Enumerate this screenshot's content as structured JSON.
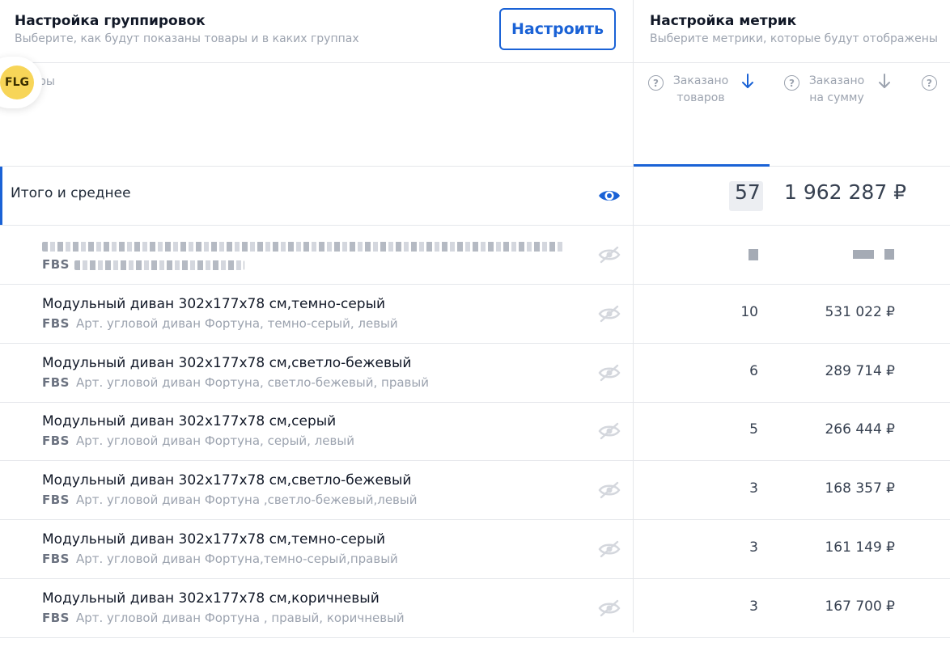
{
  "grouping": {
    "title": "Настройка группировок",
    "subtitle": "Выберите, как будут показаны товары и в каких группах",
    "button_label": "Настроить"
  },
  "metrics_settings": {
    "title": "Настройка метрик",
    "subtitle": "Выберите метрики, которые будут отображены"
  },
  "avatar": {
    "initials": "FLG",
    "color": "#f7d558"
  },
  "table": {
    "first_column_label_fragment": "ры",
    "metric_columns": [
      {
        "label_line1": "Заказано",
        "label_line2": "товаров",
        "sort": "desc-active",
        "icon": "arrow-down-icon"
      },
      {
        "label_line1": "Заказано",
        "label_line2": "на сумму",
        "sort": "desc",
        "icon": "arrow-down-icon"
      }
    ],
    "total": {
      "label": "Итого и среднее",
      "ordered_count": "57",
      "ordered_sum": "1 962 287 ₽"
    },
    "rows": [
      {
        "title": "Модульный диван 302х177х78 см,темно-серый",
        "fbs": "FBS",
        "article": "Арт. угловой диван Фортуна, темно-серый, левый",
        "count": "10",
        "sum": "531 022 ₽"
      },
      {
        "title": "Модульный диван 302х177х78 см,светло-бежевый",
        "fbs": "FBS",
        "article": "Арт. угловой диван Фортуна, светло-бежевый, правый",
        "count": "6",
        "sum": "289 714 ₽"
      },
      {
        "title": "Модульный диван 302х177х78 см,серый",
        "fbs": "FBS",
        "article": "Арт. угловой диван Фортуна, серый, левый",
        "count": "5",
        "sum": "266 444 ₽"
      },
      {
        "title": "Модульный диван 302х177х78 см,светло-бежевый",
        "fbs": "FBS",
        "article": "Арт. угловой диван Фортуна ,светло-бежевый,левый",
        "count": "3",
        "sum": "168 357 ₽"
      },
      {
        "title": "Модульный диван 302х177х78 см,темно-серый",
        "fbs": "FBS",
        "article": "Арт. угловой диван Фортуна,темно-серый,правый",
        "count": "3",
        "sum": "161 149 ₽"
      },
      {
        "title": "Модульный диван 302х177х78 см,коричневый",
        "fbs": "FBS",
        "article": "Арт. угловой диван Фортуна , правый, коричневый",
        "count": "3",
        "sum": "167 700 ₽"
      }
    ],
    "blurred_row": {
      "fbs": "FBS"
    }
  },
  "colors": {
    "accent": "#1a62d6",
    "muted": "#9ca3af"
  }
}
